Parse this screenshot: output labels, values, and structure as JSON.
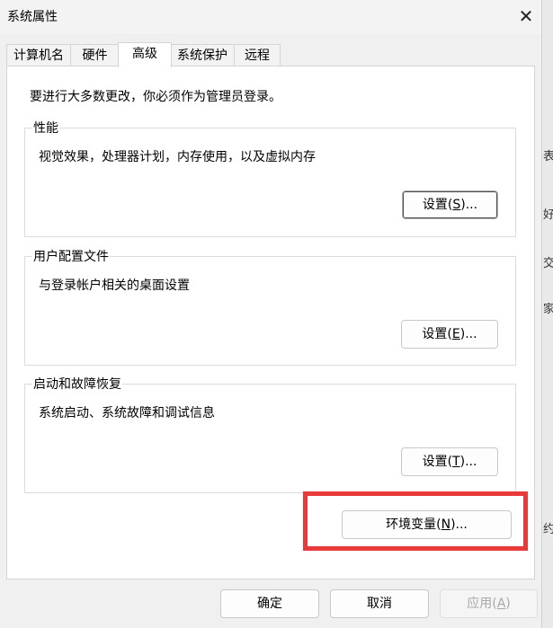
{
  "window": {
    "title": "系统属性"
  },
  "tabs": [
    {
      "label": "计算机名"
    },
    {
      "label": "硬件"
    },
    {
      "label": "高级"
    },
    {
      "label": "系统保护"
    },
    {
      "label": "远程"
    }
  ],
  "active_tab": "高级",
  "intro": "要进行大多数更改，你必须作为管理员登录。",
  "groups": {
    "performance": {
      "title": "性能",
      "description": "视觉效果，处理器计划，内存使用，以及虚拟内存",
      "button_pre": "设置(",
      "button_key": "S",
      "button_post": ")..."
    },
    "user_profiles": {
      "title": "用户配置文件",
      "description": "与登录帐户相关的桌面设置",
      "button_pre": "设置(",
      "button_key": "E",
      "button_post": ")..."
    },
    "startup_recovery": {
      "title": "启动和故障恢复",
      "description": "系统启动、系统故障和调试信息",
      "button_pre": "设置(",
      "button_key": "T",
      "button_post": ")..."
    }
  },
  "env_button": {
    "pre": "环境变量(",
    "key": "N",
    "post": ")..."
  },
  "footer": {
    "ok": "确定",
    "cancel": "取消",
    "apply_pre": "应用(",
    "apply_key": "A",
    "apply_post": ")"
  },
  "background_window_chars": [
    "表",
    "好",
    "交",
    "家",
    "约"
  ],
  "colors": {
    "highlight_box": "#e83a3a"
  }
}
